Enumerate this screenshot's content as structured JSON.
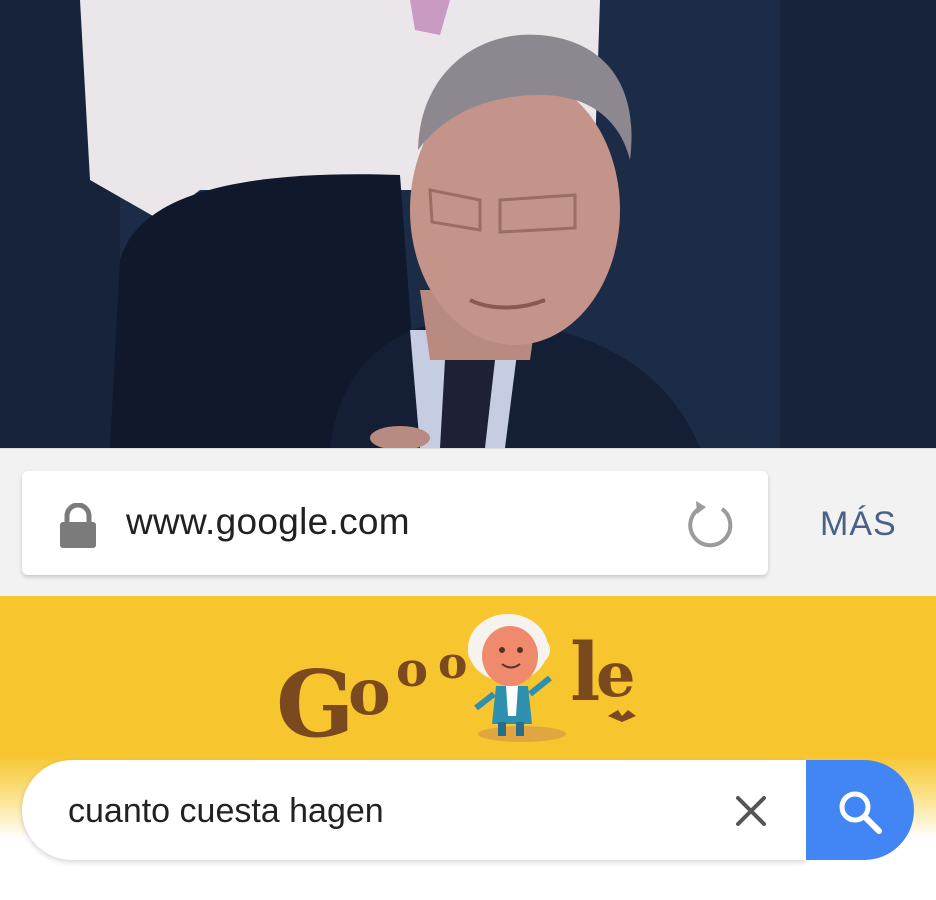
{
  "photo": {
    "icon": "photo-of-man-looking-at-phone"
  },
  "browser": {
    "url": "www.google.com",
    "lock_icon": "lock-icon",
    "reload_icon": "reload-icon",
    "more_label": "MÁS"
  },
  "google": {
    "doodle_text": "Google",
    "search": {
      "query": "cuanto cuesta hagen",
      "clear_icon": "close-icon",
      "search_icon": "search-icon"
    }
  },
  "colors": {
    "doodle_background": "#f7c52e",
    "search_button": "#4285f4",
    "more_label": "#4a6186",
    "browser_bar": "#f2f2f2"
  }
}
